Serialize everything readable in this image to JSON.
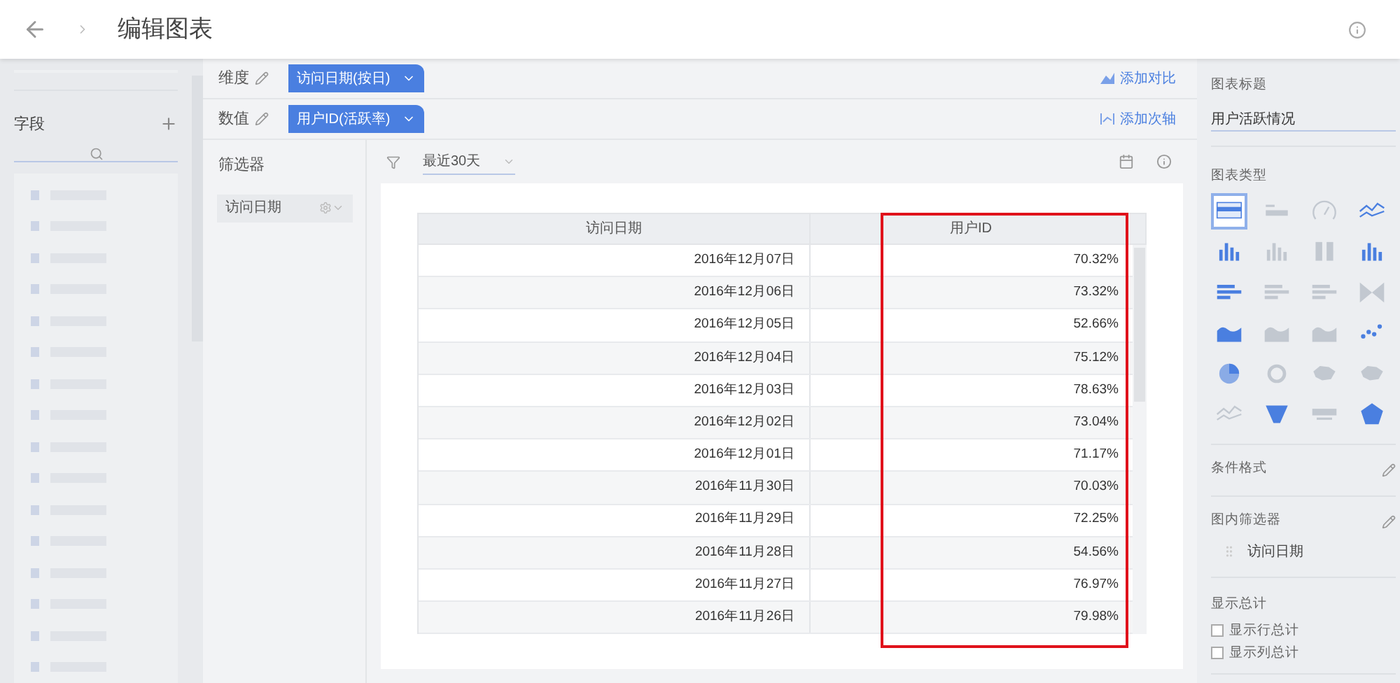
{
  "header": {
    "title": "编辑图表"
  },
  "sidebar": {
    "title": "字段"
  },
  "dimension": {
    "label": "维度",
    "pill": "访问日期(按日)",
    "action": "添加对比"
  },
  "measure": {
    "label": "数值",
    "pill": "用户ID(活跃率)",
    "action": "添加次轴"
  },
  "filters": {
    "title": "筛选器",
    "items": [
      "访问日期"
    ]
  },
  "range": {
    "value": "最近30天"
  },
  "table": {
    "columns": [
      "访问日期",
      "用户ID"
    ],
    "rows": [
      [
        "2016年12月07日",
        "70.32%"
      ],
      [
        "2016年12月06日",
        "73.32%"
      ],
      [
        "2016年12月05日",
        "52.66%"
      ],
      [
        "2016年12月04日",
        "75.12%"
      ],
      [
        "2016年12月03日",
        "78.63%"
      ],
      [
        "2016年12月02日",
        "73.04%"
      ],
      [
        "2016年12月01日",
        "71.17%"
      ],
      [
        "2016年11月30日",
        "70.03%"
      ],
      [
        "2016年11月29日",
        "72.25%"
      ],
      [
        "2016年11月28日",
        "54.56%"
      ],
      [
        "2016年11月27日",
        "76.97%"
      ],
      [
        "2016年11月26日",
        "79.98%"
      ]
    ]
  },
  "panel": {
    "title_label": "图表标题",
    "title_value": "用户活跃情况",
    "type_label": "图表类型",
    "chart_types": [
      {
        "kind": "table",
        "selected": true,
        "enabled": true
      },
      {
        "kind": "number",
        "selected": false,
        "enabled": false
      },
      {
        "kind": "gauge",
        "selected": false,
        "enabled": false
      },
      {
        "kind": "line",
        "selected": false,
        "enabled": true
      },
      {
        "kind": "bar",
        "selected": false,
        "enabled": true
      },
      {
        "kind": "bar",
        "selected": false,
        "enabled": false
      },
      {
        "kind": "stack",
        "selected": false,
        "enabled": false
      },
      {
        "kind": "bar",
        "selected": false,
        "enabled": true
      },
      {
        "kind": "hbar",
        "selected": false,
        "enabled": true
      },
      {
        "kind": "hbar",
        "selected": false,
        "enabled": false
      },
      {
        "kind": "hbar",
        "selected": false,
        "enabled": false
      },
      {
        "kind": "funnelx",
        "selected": false,
        "enabled": false
      },
      {
        "kind": "area",
        "selected": false,
        "enabled": true
      },
      {
        "kind": "area",
        "selected": false,
        "enabled": false
      },
      {
        "kind": "area",
        "selected": false,
        "enabled": false
      },
      {
        "kind": "scatter",
        "selected": false,
        "enabled": true
      },
      {
        "kind": "pie",
        "selected": false,
        "enabled": true
      },
      {
        "kind": "donut",
        "selected": false,
        "enabled": false
      },
      {
        "kind": "map",
        "selected": false,
        "enabled": false
      },
      {
        "kind": "map",
        "selected": false,
        "enabled": false
      },
      {
        "kind": "line",
        "selected": false,
        "enabled": false
      },
      {
        "kind": "funnel",
        "selected": false,
        "enabled": true
      },
      {
        "kind": "words",
        "selected": false,
        "enabled": false
      },
      {
        "kind": "radar",
        "selected": false,
        "enabled": true
      }
    ],
    "conditional_format": "条件格式",
    "inner_filter": "图内筛选器",
    "inner_filter_items": [
      "访问日期"
    ],
    "totals_label": "显示总计",
    "totals": [
      {
        "label": "显示行总计",
        "checked": false
      },
      {
        "label": "显示列总计",
        "checked": false
      }
    ]
  }
}
